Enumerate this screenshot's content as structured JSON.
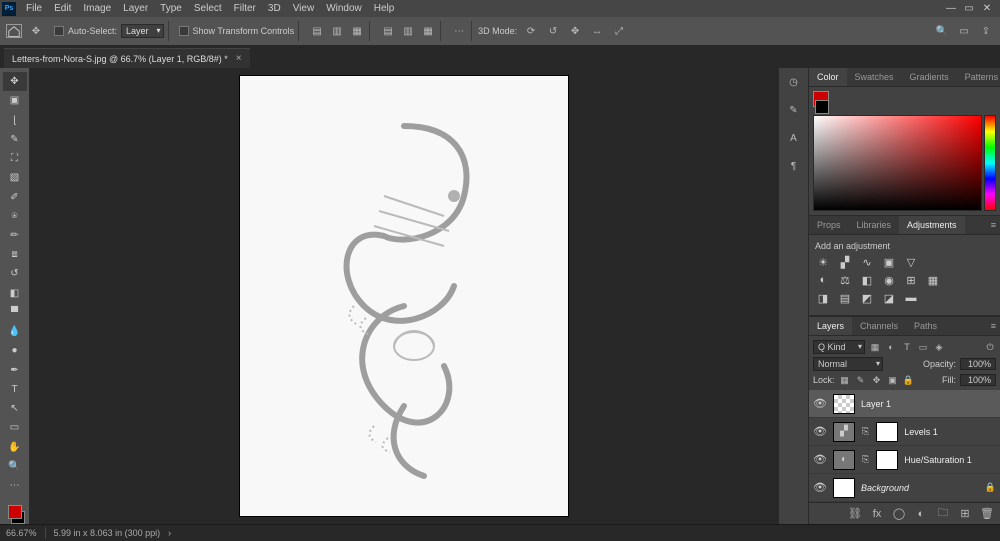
{
  "app": {
    "logo": "Ps"
  },
  "menu": {
    "file": "File",
    "edit": "Edit",
    "image": "Image",
    "layer": "Layer",
    "type": "Type",
    "select": "Select",
    "filter": "Filter",
    "threeD": "3D",
    "view": "View",
    "window": "Window",
    "help": "Help"
  },
  "optionsbar": {
    "auto_select": "Auto-Select:",
    "auto_select_value": "Layer",
    "show_controls": "Show Transform Controls",
    "threeD_mode": "3D Mode:"
  },
  "document": {
    "tab_title": "Letters-from-Nora-S.jpg @ 66.7% (Layer 1, RGB/8#) *"
  },
  "panels": {
    "color_tabs": {
      "color": "Color",
      "swatches": "Swatches",
      "gradients": "Gradients",
      "patterns": "Patterns"
    },
    "props_tabs": {
      "props": "Props",
      "libs": "Libraries",
      "adj": "Adjustments"
    },
    "adj_label": "Add an adjustment",
    "layers_tabs": {
      "layers": "Layers",
      "channels": "Channels",
      "paths": "Paths"
    }
  },
  "layers": {
    "filter": "Q Kind",
    "blend_mode": "Normal",
    "opacity_label": "Opacity:",
    "opacity_value": "100%",
    "lock_label": "Lock:",
    "fill_label": "Fill:",
    "fill_value": "100%",
    "items": [
      {
        "name": "Layer 1"
      },
      {
        "name": "Levels 1"
      },
      {
        "name": "Hue/Saturation 1"
      },
      {
        "name": "Background"
      }
    ]
  },
  "statusbar": {
    "zoom": "66.67%",
    "doc_info": "5.99 in x 8.063 in (300 ppi)"
  }
}
